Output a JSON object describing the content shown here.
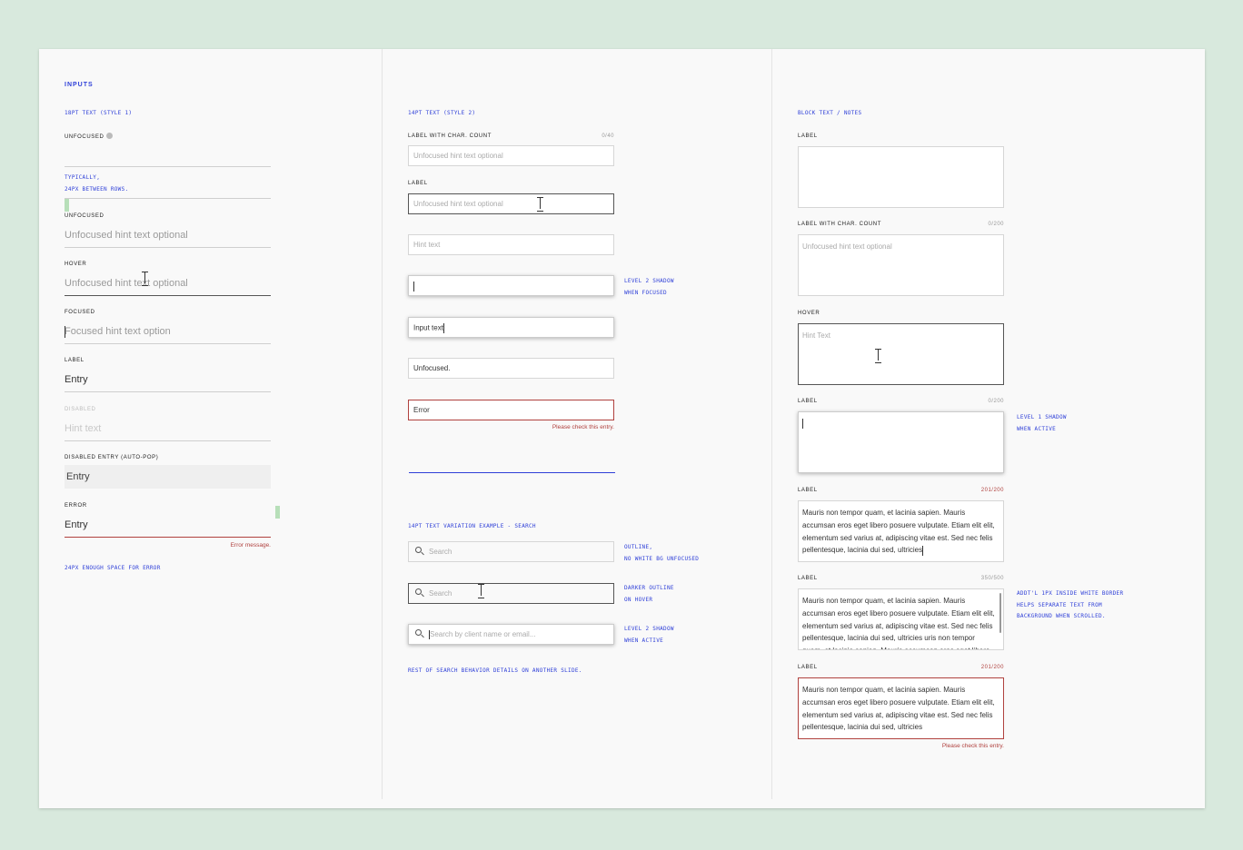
{
  "page": {
    "background": "#d8e9dd",
    "sheet_background": "#f9f9f9",
    "accent": "#2e3fd8",
    "error": "#b0413e"
  },
  "col1": {
    "title": "INPUTS",
    "style_caption": "18PT TEXT (STYLE 1)",
    "unfocused_label_1": "UNFOCUSED",
    "note_rows_1": "TYPICALLY,",
    "note_rows_2": "24PX BETWEEN ROWS.",
    "unfocused_label_2": "UNFOCUSED",
    "unfocused_hint": "Unfocused hint text optional",
    "hover_label": "HOVER",
    "hover_hint": "Unfocused hint text optional",
    "focused_label": "FOCUSED",
    "focused_hint": "Focused hint text option",
    "entry_label": "LABEL",
    "entry_value": "Entry",
    "disabled_label": "DISABLED",
    "disabled_hint": "Hint text",
    "autopop_label": "DISABLED ENTRY (AUTO-POP)",
    "autopop_value": "Entry",
    "error_label": "ERROR",
    "error_value": "Entry",
    "error_message": "Error message.",
    "error_note": "24PX ENOUGH SPACE FOR ERROR"
  },
  "col2": {
    "style_caption": "14PT TEXT (STYLE 2)",
    "charcount_label": "LABEL WITH CHAR. COUNT",
    "charcount_value": "0/40",
    "charcount_hint": "Unfocused hint text optional",
    "label": "LABEL",
    "hover_hint": "Unfocused hint text optional",
    "hint_field": "Hint text",
    "focused_note_1": "LEVEL 2 SHADOW",
    "focused_note_2": "WHEN FOCUSED",
    "input_text": "Input text",
    "unfocused_text": "Unfocused.",
    "error_text": "Error",
    "error_message": "Please check this entry.",
    "search_caption": "14PT TEXT VARIATION EXAMPLE - SEARCH",
    "search_placeholder_1": "Search",
    "search_note_1a": "OUTLINE,",
    "search_note_1b": "NO WHITE BG UNFOCUSED",
    "search_placeholder_2": "Search",
    "search_note_2a": "DARKER OUTLINE",
    "search_note_2b": "ON HOVER",
    "search_placeholder_3": "Search by client name or email...",
    "search_note_3a": "LEVEL 2 SHADOW",
    "search_note_3b": "WHEN ACTIVE",
    "search_footer": "REST OF SEARCH BEHAVIOR DETAILS ON ANOTHER SLIDE."
  },
  "col3": {
    "style_caption": "BLOCK TEXT / NOTES",
    "ta1_label": "LABEL",
    "ta2_label": "LABEL WITH CHAR. COUNT",
    "ta2_count": "0/200",
    "ta2_hint": "Unfocused hint text optional",
    "ta3_label": "HOVER",
    "ta3_hint": "Hint Text",
    "ta4_label": "LABEL",
    "ta4_count": "0/200",
    "ta4_note_1": "LEVEL 1 SHADOW",
    "ta4_note_2": "WHEN ACTIVE",
    "ta5_label": "LABEL",
    "ta5_count": "201/200",
    "ta5_text": "Mauris non tempor quam, et lacinia sapien. Mauris accumsan eros eget libero posuere vulputate. Etiam elit elit, elementum sed varius at, adipiscing vitae est. Sed nec felis pellentesque, lacinia dui sed, ultricies",
    "ta6_label": "LABEL",
    "ta6_count": "350/500",
    "ta6_text": "Mauris non tempor quam, et lacinia sapien. Mauris accumsan eros eget libero posuere vulputate. Etiam elit elit, elementum sed varius at, adipiscing vitae est. Sed nec felis pellentesque, lacinia dui sed, ultricies uris non tempor quam, et lacinia sapien. Mauris accumsan eros eget libero",
    "ta6_note_1": "ADDT'L 1PX INSIDE WHITE BORDER",
    "ta6_note_2": "HELPS SEPARATE TEXT FROM",
    "ta6_note_3": "BACKGROUND WHEN SCROLLED.",
    "ta7_label": "LABEL",
    "ta7_count": "201/200",
    "ta7_text": "Mauris non tempor quam, et lacinia sapien. Mauris accumsan eros eget libero posuere vulputate. Etiam elit elit, elementum sed varius at, adipiscing vitae est. Sed nec felis pellentesque, lacinia dui sed, ultricies",
    "ta7_error": "Please check this entry."
  }
}
